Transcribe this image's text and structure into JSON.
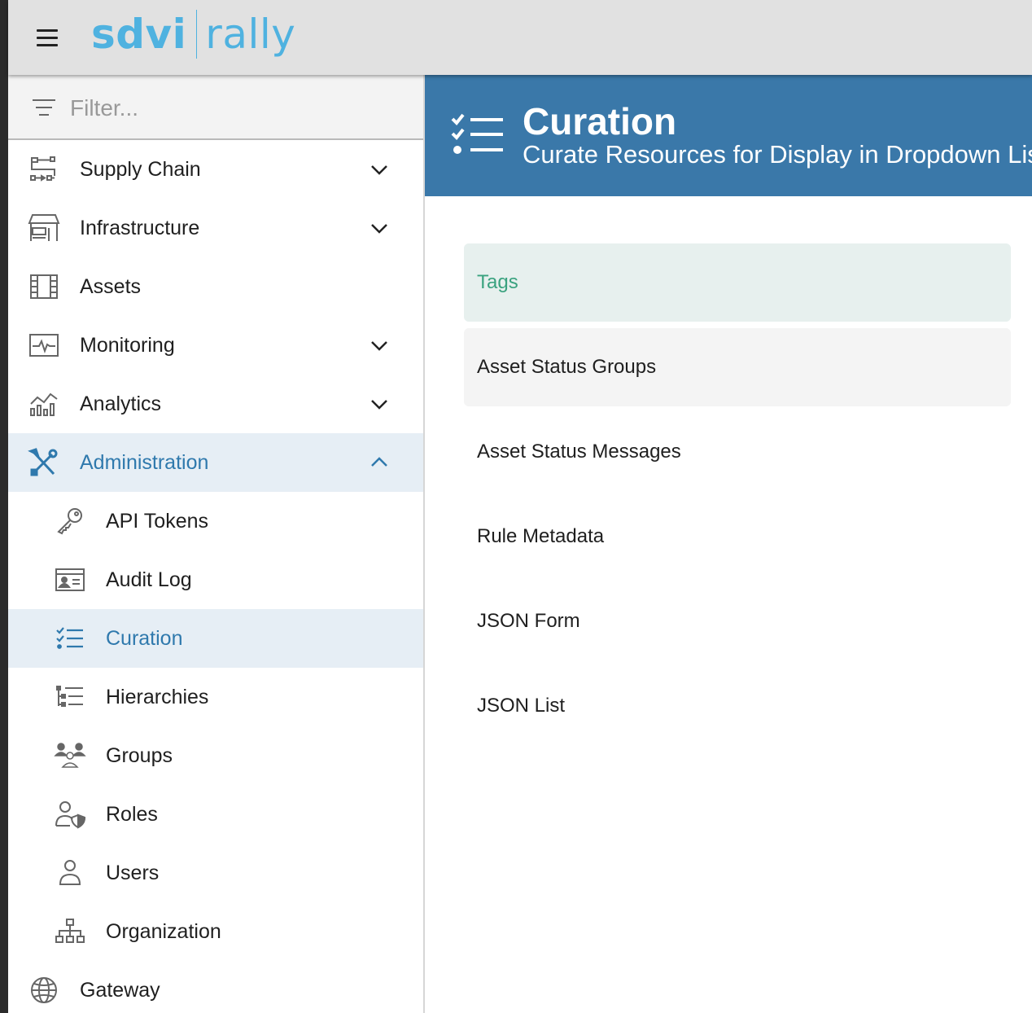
{
  "app": {
    "logo_part1": "sdvi",
    "logo_part2": "rally"
  },
  "sidebar": {
    "filter_placeholder": "Filter...",
    "items": [
      {
        "label": "Supply Chain",
        "icon": "supply-chain-icon",
        "expandable": true,
        "expanded": false
      },
      {
        "label": "Infrastructure",
        "icon": "infrastructure-icon",
        "expandable": true,
        "expanded": false
      },
      {
        "label": "Assets",
        "icon": "film-icon",
        "expandable": false
      },
      {
        "label": "Monitoring",
        "icon": "monitor-pulse-icon",
        "expandable": true,
        "expanded": false
      },
      {
        "label": "Analytics",
        "icon": "analytics-chart-icon",
        "expandable": true,
        "expanded": false
      },
      {
        "label": "Administration",
        "icon": "tools-icon",
        "expandable": true,
        "expanded": true,
        "active": true
      },
      {
        "label": "API Tokens",
        "icon": "key-icon",
        "sub": true
      },
      {
        "label": "Audit Log",
        "icon": "id-card-icon",
        "sub": true
      },
      {
        "label": "Curation",
        "icon": "checklist-icon",
        "sub": true,
        "active": true
      },
      {
        "label": "Hierarchies",
        "icon": "tree-list-icon",
        "sub": true
      },
      {
        "label": "Groups",
        "icon": "group-icon",
        "sub": true
      },
      {
        "label": "Roles",
        "icon": "user-shield-icon",
        "sub": true
      },
      {
        "label": "Users",
        "icon": "user-icon",
        "sub": true
      },
      {
        "label": "Organization",
        "icon": "org-chart-icon",
        "sub": true
      },
      {
        "label": "Gateway",
        "icon": "globe-icon",
        "expandable": false
      }
    ]
  },
  "header": {
    "title": "Curation",
    "subtitle": "Curate Resources for Display in Dropdown Lists",
    "icon": "checklist-icon"
  },
  "curation_list": [
    {
      "label": "Tags",
      "state": "selected"
    },
    {
      "label": "Asset Status Groups",
      "state": "hovered"
    },
    {
      "label": "Asset Status Messages",
      "state": "normal"
    },
    {
      "label": "Rule Metadata",
      "state": "normal"
    },
    {
      "label": "JSON Form",
      "state": "normal"
    },
    {
      "label": "JSON List",
      "state": "normal"
    }
  ],
  "colors": {
    "accent": "#3a78a9",
    "active_text": "#2f79ad",
    "active_bg": "#e6eef5",
    "selected_text": "#3aa27f",
    "selected_bg": "#e7f0ee",
    "logo": "#4fb2e0"
  }
}
